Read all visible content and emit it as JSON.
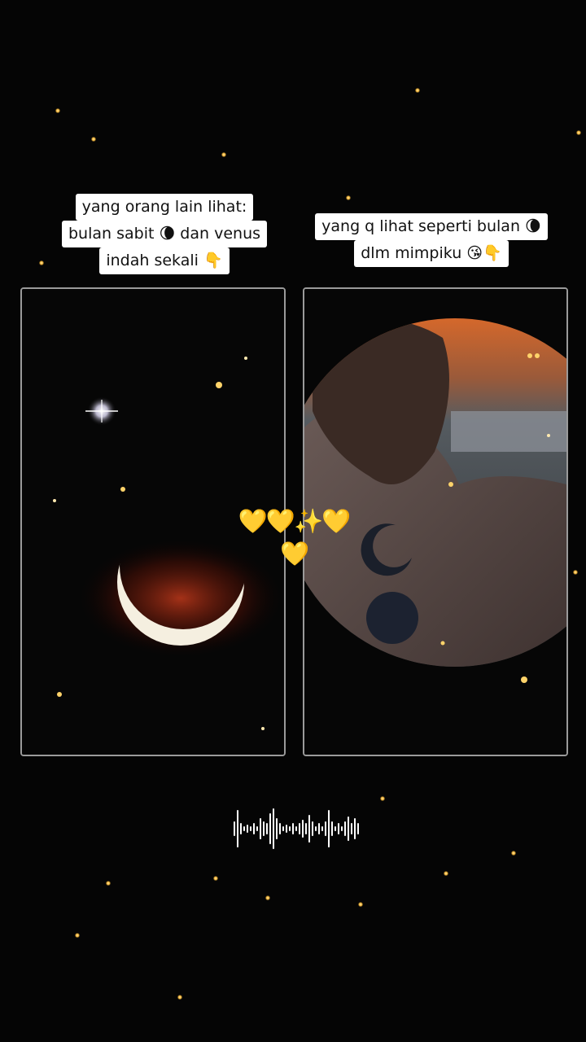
{
  "caption_left": {
    "line1": "yang orang lain lihat:",
    "line2": "bulan sabit 🌘 dan venus",
    "line3": "indah sekali 👇"
  },
  "caption_right": {
    "line1": "yang q lihat seperti bulan 🌘",
    "line2": "dlm mimpiku 😘👇"
  },
  "center_decoration": "💛💛✨💛💛",
  "icons": {
    "left_panel": "crescent-moon-venus-photo",
    "right_panel": "moon-tattoo-photo",
    "audio": "audio-waveform-icon"
  },
  "colors": {
    "background": "#050505",
    "frame_border": "#9a9a9a",
    "star_glow": "#f5b73b",
    "caption_bg": "#ffffff"
  }
}
